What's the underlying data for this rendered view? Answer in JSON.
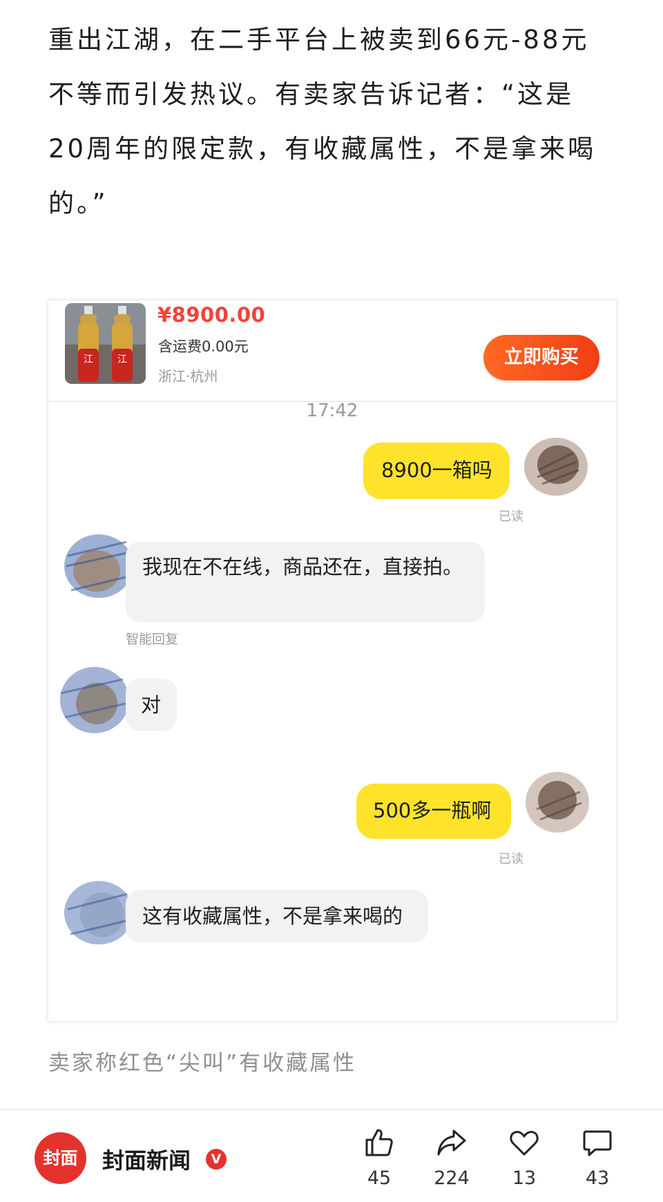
{
  "article": {
    "lines": [
      "重出江湖，在二手平台上被卖到66元-88元",
      "不等而引发热议。有卖家告诉记者：“这是",
      "20周年的限定款，有收藏属性，不是拿来喝",
      "的。”"
    ]
  },
  "listing": {
    "price": "¥8900.00",
    "shipping": "含运费0.00元",
    "location": "浙江·杭州",
    "buy_label": "立即购买"
  },
  "chat": {
    "time": "17:42",
    "msg1": "8900一箱吗",
    "read1": "已读",
    "msg2": "我现在不在线，商品还在，直接拍。",
    "smart_reply": "智能回复",
    "msg3": "对",
    "msg4": "500多一瓶啊",
    "read2": "已读",
    "msg5": "这有收藏属性，不是拿来喝的"
  },
  "caption": "卖家称红色“尖叫”有收藏属性",
  "footer": {
    "logo_text": "封面",
    "source": "封面新闻",
    "badge": "V",
    "likes": "45",
    "shares": "224",
    "favorites": "13",
    "comments": "43"
  },
  "colors": {
    "price_red": "#f44336",
    "buy_orange": "#f24e1e",
    "bubble_yellow": "#ffe32a",
    "bubble_gray": "#f2f2f2",
    "brand_red": "#e5322d"
  }
}
